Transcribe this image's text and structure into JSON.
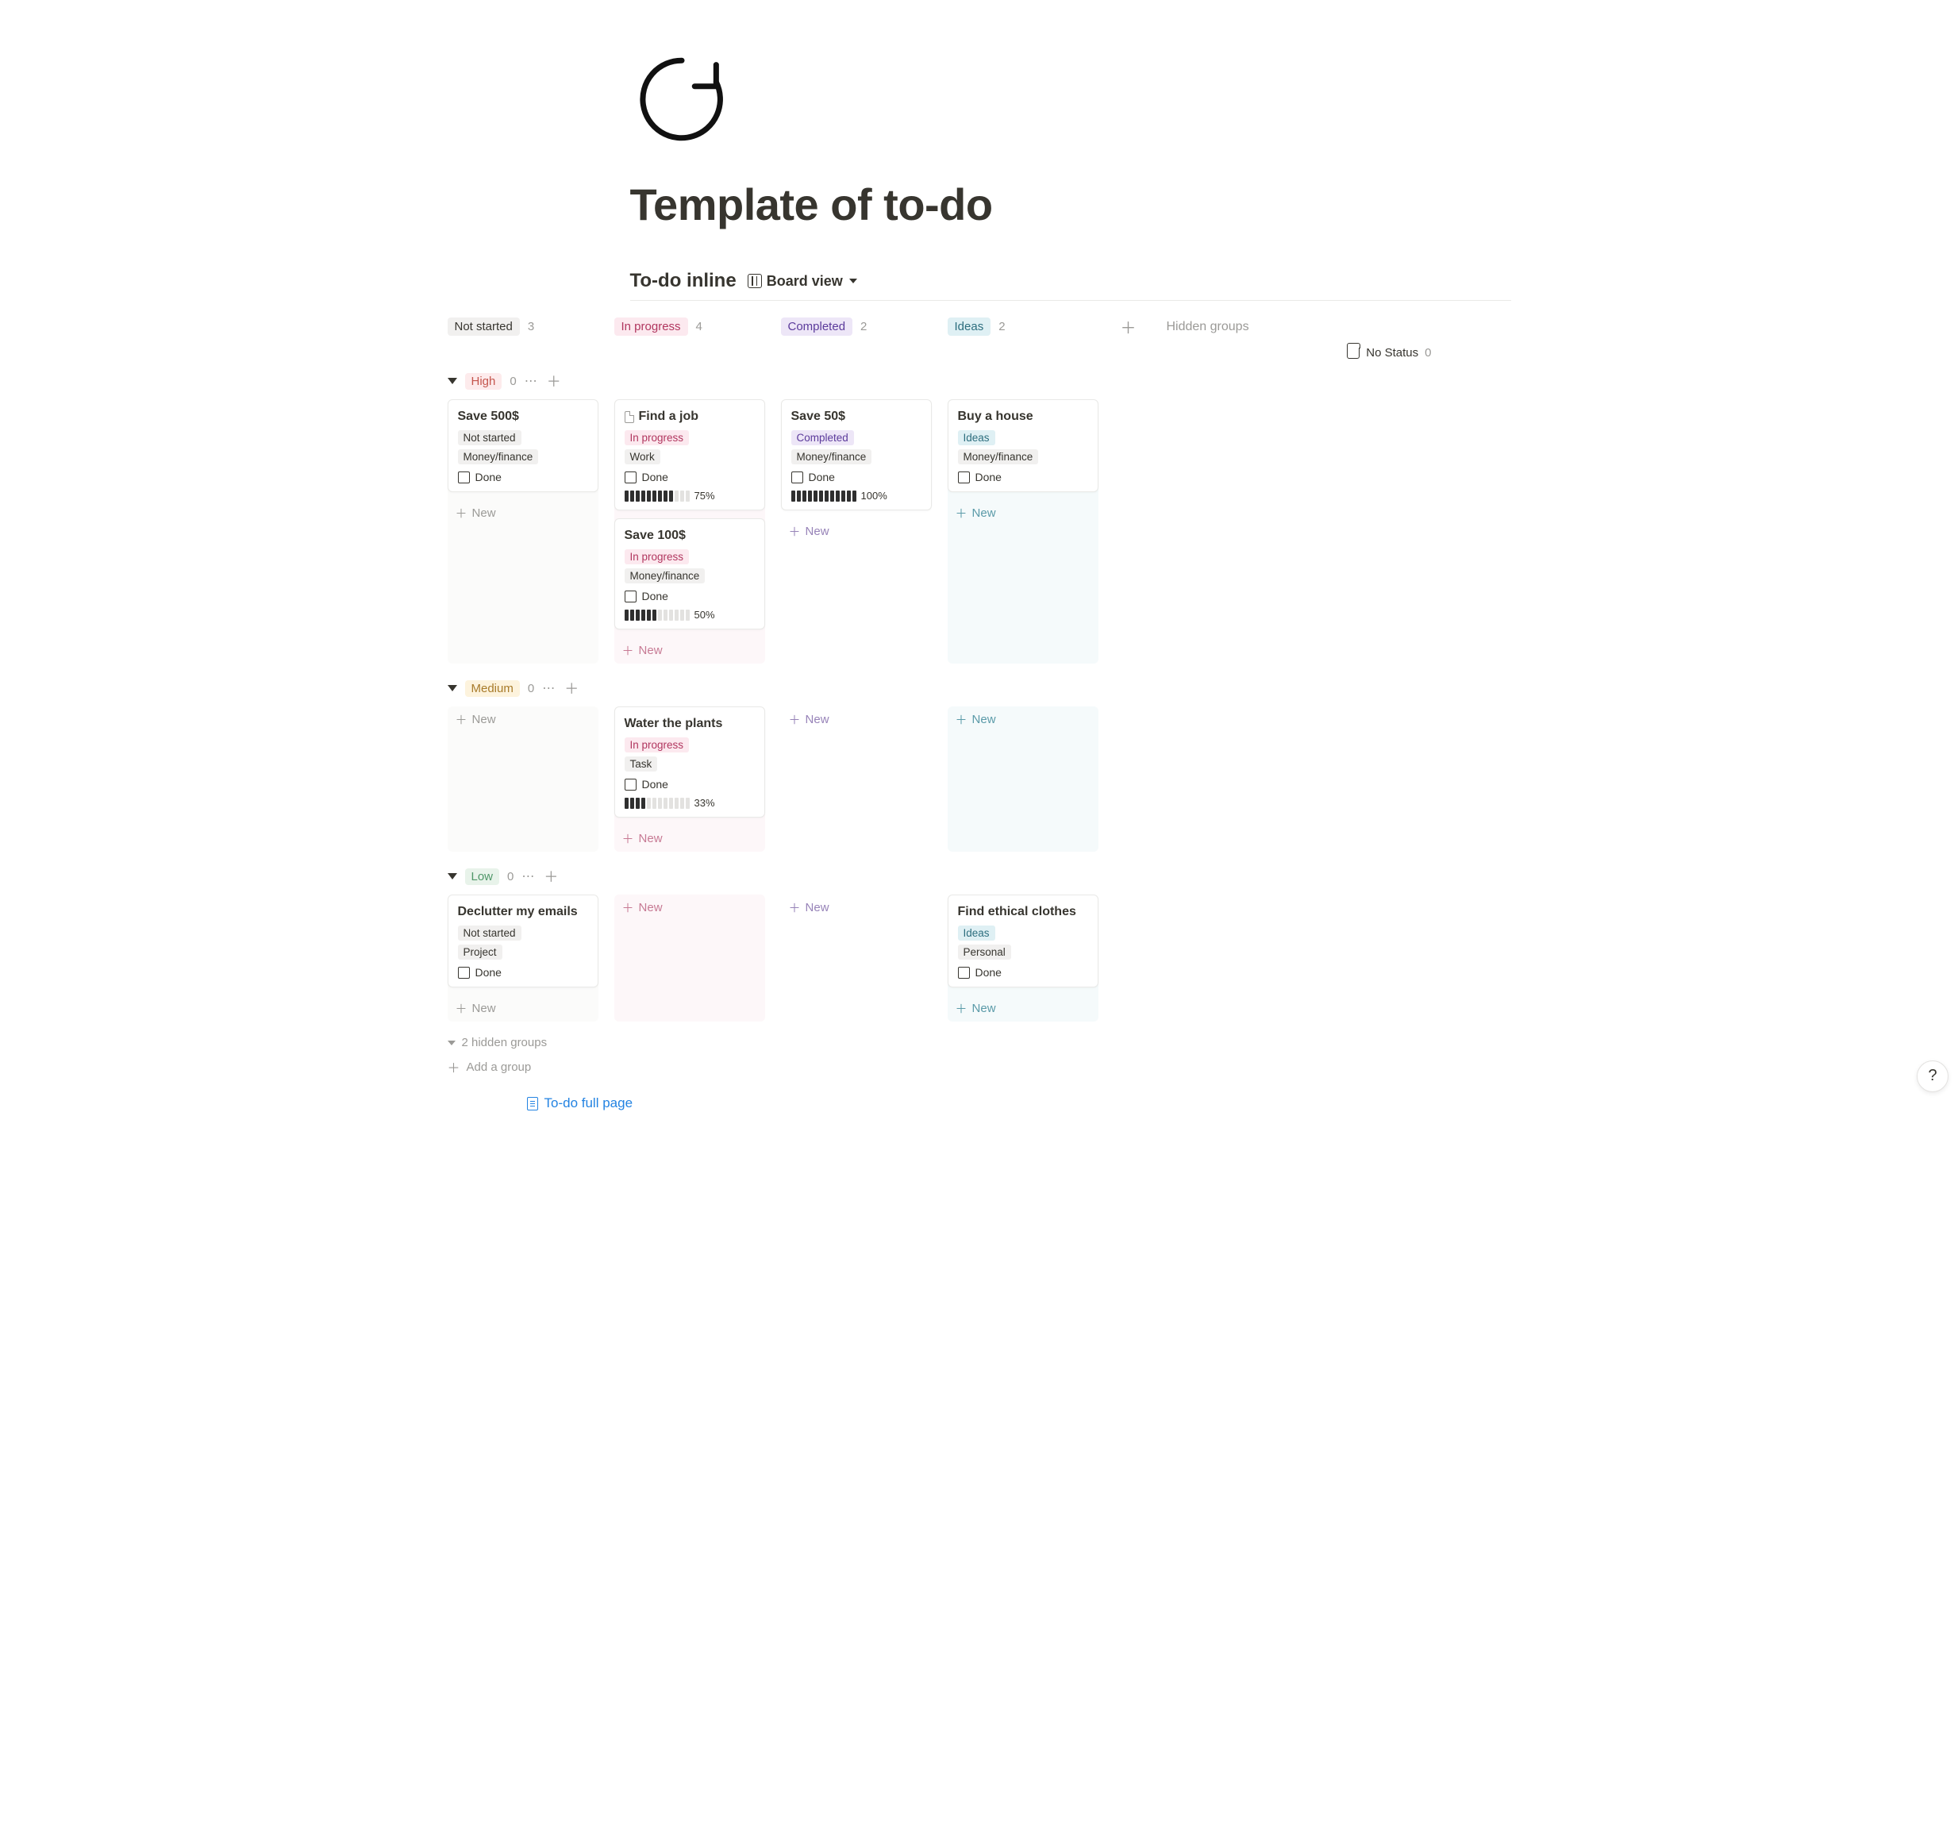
{
  "page": {
    "title": "Template of to-do"
  },
  "database": {
    "title": "To-do inline",
    "view_label": "Board view"
  },
  "columns": [
    {
      "label": "Not started",
      "count": "3",
      "pill_class": "pill-notstarted"
    },
    {
      "label": "In progress",
      "count": "4",
      "pill_class": "pill-inprogress"
    },
    {
      "label": "Completed",
      "count": "2",
      "pill_class": "pill-completed"
    },
    {
      "label": "Ideas",
      "count": "2",
      "pill_class": "pill-ideas"
    }
  ],
  "hidden_groups_label": "Hidden groups",
  "no_status": {
    "label": "No Status",
    "count": "0"
  },
  "new_label": "New",
  "done_label": "Done",
  "groups": [
    {
      "name": "High",
      "count": "0",
      "class": "grp-high",
      "lanes": {
        "not_started": [
          {
            "title": "Save 500$",
            "status": "Not started",
            "status_class": "tag-notstarted",
            "category": "Money/finance",
            "cat_class": "tag-money",
            "done_checked": false
          }
        ],
        "in_progress": [
          {
            "title": "Find a job",
            "has_doc_icon": true,
            "status": "In progress",
            "status_class": "tag-inprogress",
            "category": "Work",
            "cat_class": "tag-work",
            "done_checked": false,
            "progress": {
              "filled": 9,
              "total": 12,
              "pct": "75%"
            }
          },
          {
            "title": "Save 100$",
            "status": "In progress",
            "status_class": "tag-inprogress",
            "category": "Money/finance",
            "cat_class": "tag-money",
            "done_checked": false,
            "progress": {
              "filled": 6,
              "total": 12,
              "pct": "50%"
            }
          }
        ],
        "completed": [
          {
            "title": "Save 50$",
            "status": "Completed",
            "status_class": "tag-completed",
            "category": "Money/finance",
            "cat_class": "tag-money",
            "done_checked": false,
            "progress": {
              "filled": 12,
              "total": 12,
              "pct": "100%"
            }
          }
        ],
        "ideas": [
          {
            "title": "Buy a house",
            "status": "Ideas",
            "status_class": "tag-ideas",
            "category": "Money/finance",
            "cat_class": "tag-money",
            "done_checked": false
          }
        ]
      }
    },
    {
      "name": "Medium",
      "count": "0",
      "class": "grp-medium",
      "lanes": {
        "not_started": [],
        "in_progress": [
          {
            "title": "Water the plants",
            "status": "In progress",
            "status_class": "tag-inprogress",
            "category": "Task",
            "cat_class": "tag-task",
            "done_checked": false,
            "progress": {
              "filled": 4,
              "total": 12,
              "pct": "33%"
            }
          }
        ],
        "completed": [],
        "ideas": []
      }
    },
    {
      "name": "Low",
      "count": "0",
      "class": "grp-low",
      "lanes": {
        "not_started": [
          {
            "title": "Declutter my emails",
            "status": "Not started",
            "status_class": "tag-notstarted",
            "category": "Project",
            "cat_class": "tag-project",
            "done_checked": false
          }
        ],
        "in_progress": [],
        "completed": [],
        "ideas": [
          {
            "title": "Find ethical clothes",
            "status": "Ideas",
            "status_class": "tag-ideas",
            "category": "Personal",
            "cat_class": "tag-personal",
            "done_checked": false
          }
        ]
      }
    }
  ],
  "footer": {
    "hidden_groups": "2 hidden groups",
    "add_group": "Add a group",
    "full_page_link": "To-do full page"
  },
  "help_label": "?"
}
